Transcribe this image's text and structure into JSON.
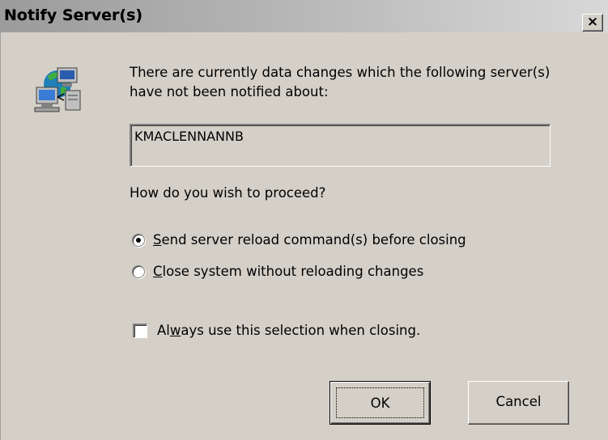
{
  "window": {
    "title": "Notify Server(s)",
    "close_glyph": "×"
  },
  "icon": "network-servers-icon",
  "message": "There are currently data changes which the following server(s) have not been notified about:",
  "servers": [
    "KMACLENNANNB"
  ],
  "question": "How do you wish to proceed?",
  "options": {
    "send_reload": {
      "prefix": "",
      "accel": "S",
      "rest": "end server reload command(s) before closing",
      "checked": true
    },
    "close_without": {
      "prefix": "",
      "accel": "C",
      "rest": "lose system without reloading changes",
      "checked": false
    }
  },
  "always_use": {
    "prefix": "Al",
    "accel": "w",
    "rest": "ays use this selection when closing.",
    "checked": false
  },
  "buttons": {
    "ok": "OK",
    "cancel": "Cancel"
  },
  "colors": {
    "face": "#d4d0c8",
    "title_gradient_start": "#9b9b9b",
    "title_gradient_end": "#d8d8d8"
  }
}
